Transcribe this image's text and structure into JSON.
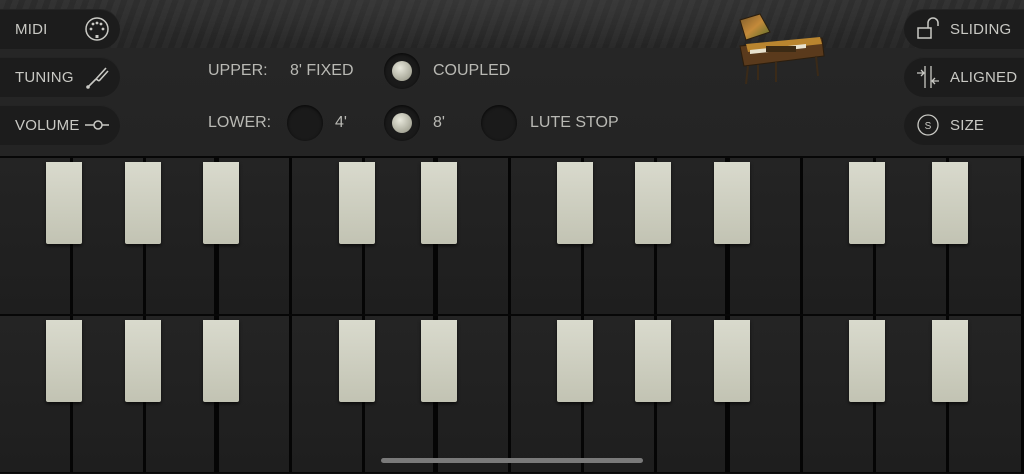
{
  "left_buttons": [
    {
      "id": "midi",
      "label": "MIDI",
      "icon": "midi-din-icon"
    },
    {
      "id": "tuning",
      "label": "TUNING",
      "icon": "tuning-fork-icon"
    },
    {
      "id": "volume",
      "label": "VOLUME",
      "icon": "volume-slider-icon"
    }
  ],
  "right_buttons": [
    {
      "id": "sliding",
      "label": "SLIDING",
      "icon": "unlocked-padlock-icon"
    },
    {
      "id": "aligned",
      "label": "ALIGNED",
      "icon": "align-arrows-icon"
    },
    {
      "id": "size",
      "label": "SIZE",
      "icon": "size-circle-s-icon"
    }
  ],
  "registers": {
    "upper_label": "UPPER:",
    "upper_value": "8' FIXED",
    "coupled": {
      "label": "COUPLED",
      "on": true
    },
    "lower_label": "LOWER:",
    "lower_4": {
      "label": "4'",
      "on": false
    },
    "lower_8": {
      "label": "8'",
      "on": true
    },
    "lute_stop": {
      "label": "LUTE STOP",
      "on": false
    }
  },
  "instrument_image": "harpsichord-thumbnail",
  "colors": {
    "ivory": "#d2d3c4",
    "key_dark": "#212121",
    "panel": "#272727"
  }
}
